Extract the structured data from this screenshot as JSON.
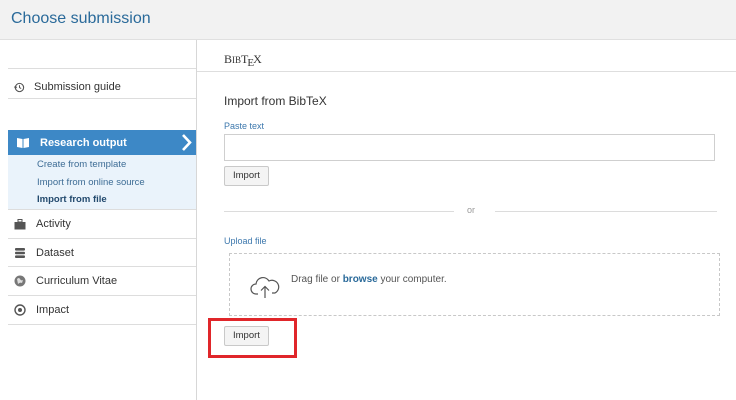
{
  "header": {
    "title": "Choose submission"
  },
  "sidebar": {
    "guide": {
      "label": "Submission guide",
      "icon": "clock-arrow-icon"
    },
    "research_output": {
      "label": "Research output",
      "items": [
        "Create from template",
        "Import from online source",
        "Import from file"
      ]
    },
    "nav": [
      {
        "label": "Activity",
        "icon": "briefcase-icon"
      },
      {
        "label": "Dataset",
        "icon": "database-icon"
      },
      {
        "label": "Curriculum Vitae",
        "icon": "globe-icon"
      },
      {
        "label": "Impact",
        "icon": "target-icon"
      }
    ]
  },
  "main": {
    "logo_text": {
      "b": "B",
      "ib": "IB",
      "t": "T",
      "e": "E",
      "x": "X"
    },
    "heading": "Import from BibTeX",
    "paste_label": "Paste text",
    "paste_value": "",
    "import_label": "Import",
    "or_text": "or",
    "upload_label": "Upload file",
    "drop": {
      "pre": "Drag file or ",
      "link": "browse",
      "post": " your computer."
    },
    "import_label_2": "Import"
  },
  "colors": {
    "accent": "#3d88c6",
    "link": "#2a6a9a",
    "highlight": "#e0262a"
  }
}
